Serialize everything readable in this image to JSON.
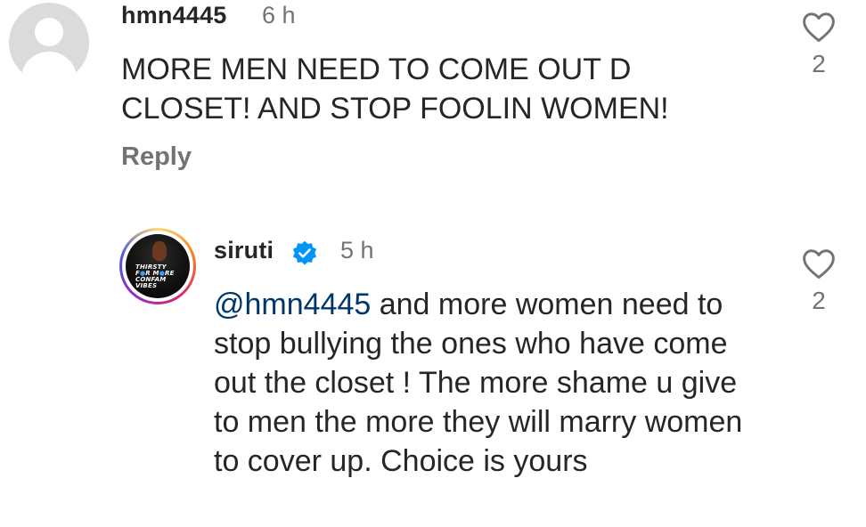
{
  "comments": [
    {
      "username": "hmn4445",
      "time": "6 h",
      "text": "MORE MEN NEED TO COME OUT D CLOSET! AND STOP FOOLIN WOMEN!",
      "reply_label": "Reply",
      "like_count": "2",
      "icons": {
        "avatar": "default-avatar-icon",
        "like": "heart-outline-icon"
      }
    },
    {
      "username": "siruti",
      "time": "5 h",
      "mention": "@hmn4445",
      "text": " and more women need to stop bullying the ones who have come out the closet ! The more shame u give to men the more they will marry women to cover up. Choice is yours",
      "like_count": "2",
      "avatar_text": {
        "line1": "THIRSTY",
        "line2": "F",
        "line2b": "R M",
        "line2c": "RE",
        "line3": "CONFAM",
        "line4": "VIBES"
      },
      "icons": {
        "verified": "verified-badge-icon",
        "like": "heart-outline-icon"
      }
    }
  ],
  "colors": {
    "text": "#262626",
    "secondary": "#737373",
    "mention": "#00376b",
    "verified": "#0095f6"
  }
}
